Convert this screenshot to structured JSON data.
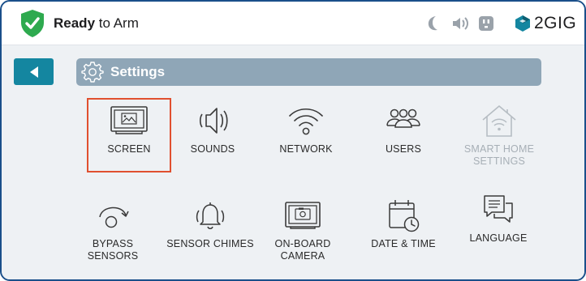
{
  "status": {
    "strong": "Ready",
    "rest": " to Arm",
    "color": "#2eaa4f"
  },
  "topbar_icons": [
    "moon-icon",
    "speaker-icon",
    "outlet-icon"
  ],
  "brand": {
    "name": "2GIG",
    "color": "#1486a0"
  },
  "back_button": {
    "icon": "back-arrow-icon"
  },
  "title": {
    "label": "Settings",
    "icon": "gear-icon"
  },
  "tiles": [
    {
      "id": "screen",
      "label": "SCREEN",
      "icon": "screen-icon",
      "selected": true
    },
    {
      "id": "sounds",
      "label": "SOUNDS",
      "icon": "speaker-waves-icon"
    },
    {
      "id": "network",
      "label": "NETWORK",
      "icon": "wifi-icon"
    },
    {
      "id": "users",
      "label": "USERS",
      "icon": "users-icon"
    },
    {
      "id": "smart-home",
      "label_line1": "SMART HOME",
      "label_line2": "SETTINGS",
      "icon": "smart-home-icon",
      "disabled": true
    },
    {
      "id": "bypass",
      "label_line1": "BYPASS",
      "label_line2": "SENSORS",
      "icon": "bypass-icon"
    },
    {
      "id": "sensor-chimes",
      "label": "SENSOR CHIMES",
      "icon": "bell-icon"
    },
    {
      "id": "camera",
      "label_line1": "ON-BOARD",
      "label_line2": "CAMERA",
      "icon": "camera-icon"
    },
    {
      "id": "date-time",
      "label": "DATE & TIME",
      "icon": "calendar-clock-icon"
    },
    {
      "id": "language",
      "label": "LANGUAGE",
      "icon": "chat-bubbles-icon"
    }
  ],
  "colors": {
    "accent": "#1486a0",
    "header_bar": "#8fa6b7",
    "selection": "#e0502f",
    "frame": "#1a4f8a"
  }
}
